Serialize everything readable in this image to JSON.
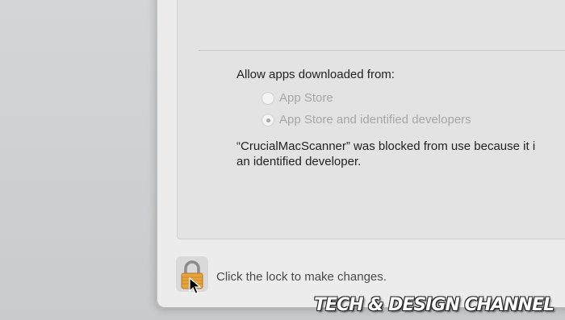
{
  "security": {
    "allow_label": "Allow apps downloaded from:",
    "options": [
      {
        "label": "App Store",
        "selected": false
      },
      {
        "label": "App Store and identified developers",
        "selected": true
      }
    ],
    "blocked_line1": "“CrucialMacScanner” was blocked from use because it i",
    "blocked_line2": "an identified developer."
  },
  "footer": {
    "lock_icon": "lock-icon",
    "lock_hint": "Click the lock to make changes."
  },
  "watermark": "TECH & DESIGN CHANNEL",
  "colors": {
    "window_bg": "#ececec",
    "panel_bg": "#e3e3e3",
    "disabled_text": "#a6a6a6",
    "lock_gold": "#e8a33a"
  }
}
